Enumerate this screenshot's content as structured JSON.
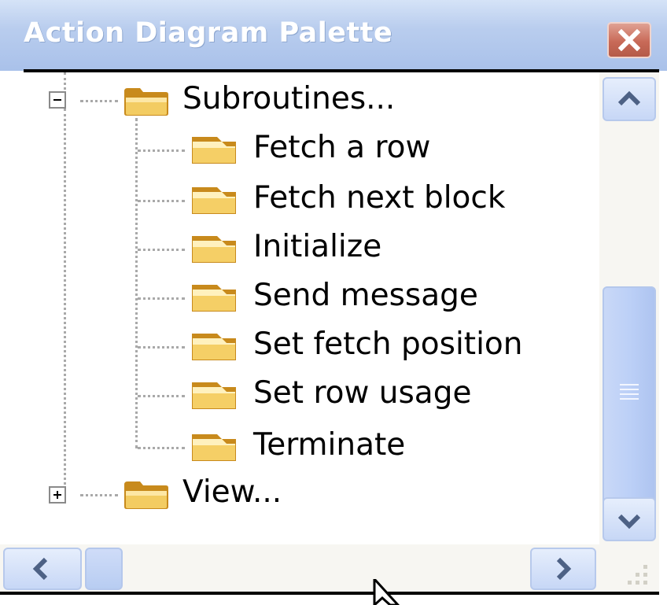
{
  "window": {
    "title": "Action Diagram Palette",
    "close_icon": "close-icon",
    "accent_color": "#a9c1ea",
    "close_color": "#c86a58"
  },
  "tree": {
    "root_nodes": [
      {
        "label": "Subroutines...",
        "expanded": true,
        "icon": "folder-open-icon",
        "children": [
          {
            "label": "Fetch a row",
            "icon": "folder-icon"
          },
          {
            "label": "Fetch next block",
            "icon": "folder-icon"
          },
          {
            "label": "Initialize",
            "icon": "folder-icon"
          },
          {
            "label": "Send message",
            "icon": "folder-icon"
          },
          {
            "label": "Set fetch position",
            "icon": "folder-icon"
          },
          {
            "label": "Set row usage",
            "icon": "folder-icon"
          },
          {
            "label": "Terminate",
            "icon": "folder-icon"
          }
        ]
      },
      {
        "label": "View...",
        "expanded": false,
        "icon": "folder-open-icon"
      }
    ]
  },
  "scrollbars": {
    "vertical": {
      "up_icon": "chevron-up-icon",
      "down_icon": "chevron-down-icon"
    },
    "horizontal": {
      "left_icon": "chevron-left-icon",
      "right_icon": "chevron-right-icon"
    }
  }
}
